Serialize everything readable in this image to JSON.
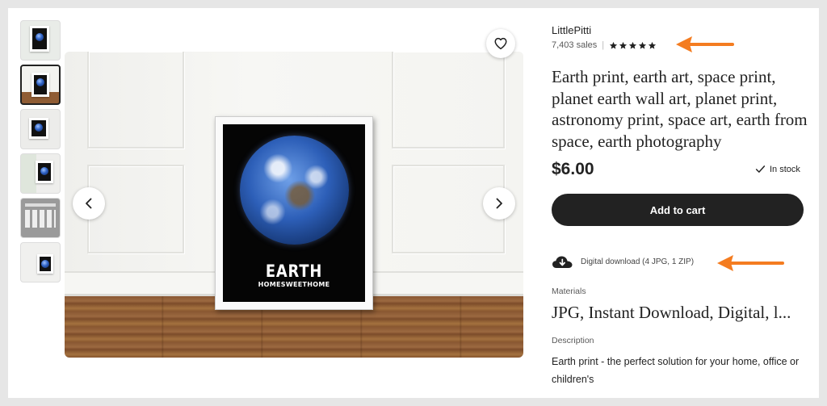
{
  "gallery": {
    "thumbnails": [
      {
        "label": "thumbnail-1",
        "active": false
      },
      {
        "label": "thumbnail-2",
        "active": true
      },
      {
        "label": "thumbnail-3",
        "active": false
      },
      {
        "label": "thumbnail-4",
        "active": false
      },
      {
        "label": "thumbnail-5",
        "active": false
      },
      {
        "label": "thumbnail-6",
        "active": false
      }
    ],
    "poster_title": "EARTH",
    "poster_subtitle": "HOMESWEETHOME",
    "prev_icon": "chevron-left-icon",
    "next_icon": "chevron-right-icon",
    "favorite_icon": "heart-icon"
  },
  "listing": {
    "shop_name": "LittlePitti",
    "sales": "7,403 sales",
    "rating_stars": 5,
    "title": "Earth print, earth art, space print, planet earth wall art, planet print, astronomy print, space art, earth from space, earth photography",
    "price": "$6.00",
    "stock": "In stock",
    "add_to_cart": "Add to cart",
    "download_text": "Digital download (4 JPG, 1 ZIP)",
    "materials_label": "Materials",
    "materials_value": "JPG, Instant Download, Digital, l...",
    "description_label": "Description",
    "description_text": "Earth print - the perfect solution for your home, office or children's"
  },
  "annotations": {
    "arrow_color": "#f47c20"
  },
  "colors": {
    "button_bg": "#222222",
    "page_bg": "#e6e6e6"
  }
}
